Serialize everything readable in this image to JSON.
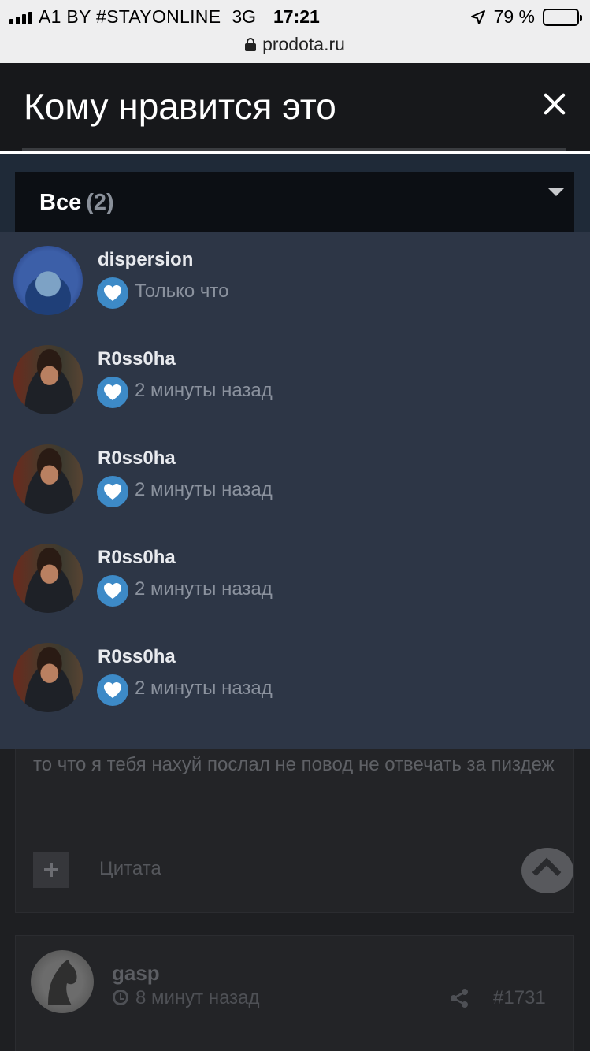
{
  "status_bar": {
    "carrier": "A1 BY #STAYONLINE",
    "network": "3G",
    "time": "17:21",
    "battery": "79 %",
    "battery_level_percent": 79
  },
  "address_bar": {
    "url": "prodota.ru"
  },
  "modal": {
    "title": "Кому нравится это",
    "filter": {
      "label": "Все",
      "count": "(2)"
    },
    "likes": [
      {
        "username": "dispersion",
        "time": "Только что",
        "avatar": "jesus-portrait"
      },
      {
        "username": "R0ss0ha",
        "time": "2 минуты назад",
        "avatar": "man-portrait"
      },
      {
        "username": "R0ss0ha",
        "time": "2 минуты назад",
        "avatar": "man-portrait"
      },
      {
        "username": "R0ss0ha",
        "time": "2 минуты назад",
        "avatar": "man-portrait"
      },
      {
        "username": "R0ss0ha",
        "time": "2 минуты назад",
        "avatar": "man-portrait"
      }
    ],
    "reaction_icon": "heart-icon",
    "colors": {
      "reaction_badge": "#3d8ac7",
      "list_background": "#2d3646"
    }
  },
  "background_page": {
    "post_text": "то что я тебя нахуй послал не повод не отвечать за пиздеж",
    "quote_label": "Цитата",
    "next_post": {
      "username": "gasp",
      "time": "8 минут назад",
      "post_number": "#1731"
    }
  }
}
